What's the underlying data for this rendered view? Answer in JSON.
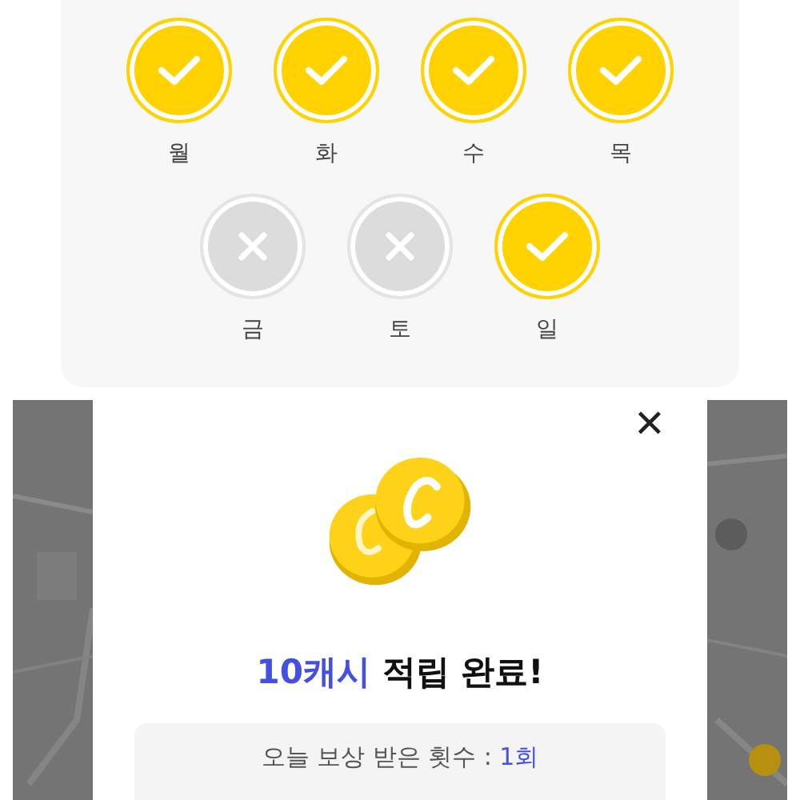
{
  "attendance": {
    "days": [
      {
        "label": "월",
        "checked": true
      },
      {
        "label": "화",
        "checked": true
      },
      {
        "label": "수",
        "checked": true
      },
      {
        "label": "목",
        "checked": true
      },
      {
        "label": "금",
        "checked": false
      },
      {
        "label": "토",
        "checked": false
      },
      {
        "label": "일",
        "checked": true
      }
    ]
  },
  "dialog": {
    "close": "✕",
    "title_highlight": "10캐시",
    "title_rest": "적립 완료!",
    "info_label": "오늘 보상 받은 횟수 : ",
    "info_value": "1회"
  }
}
